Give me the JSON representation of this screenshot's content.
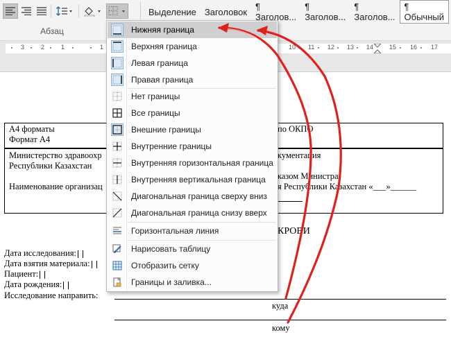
{
  "ribbon": {
    "group_label": "Абзац",
    "styles": [
      "Выделение",
      "Заголовок",
      "¶ Заголов...",
      "¶ Заголов...",
      "¶ Заголов...",
      "¶ Обычный",
      "П"
    ]
  },
  "ruler": {
    "numbers": [
      "3",
      "2",
      "1",
      "1",
      "2",
      "3",
      "4",
      "5",
      "6",
      "7",
      "8",
      "9",
      "10",
      "11",
      "12",
      "13",
      "14",
      "15",
      "16",
      "17"
    ]
  },
  "menu": {
    "items": [
      {
        "label": "Нижняя граница",
        "icon": "bottom-border-icon"
      },
      {
        "label": "Верхняя граница",
        "icon": "top-border-icon"
      },
      {
        "label": "Левая граница",
        "icon": "left-border-icon"
      },
      {
        "label": "Правая граница",
        "icon": "right-border-icon"
      },
      {
        "label": "Нет границы",
        "icon": "no-border-icon"
      },
      {
        "label": "Все границы",
        "icon": "all-borders-icon"
      },
      {
        "label": "Внешние границы",
        "icon": "outside-borders-icon"
      },
      {
        "label": "Внутренние границы",
        "icon": "inside-borders-icon"
      },
      {
        "label": "Внутренняя горизонтальная граница",
        "icon": "inside-horizontal-border-icon"
      },
      {
        "label": "Внутренняя вертикальная граница",
        "icon": "inside-vertical-border-icon"
      },
      {
        "label": "Диагональная граница сверху вниз",
        "icon": "diagonal-down-border-icon"
      },
      {
        "label": "Диагональная граница снизу вверх",
        "icon": "diagonal-up-border-icon"
      },
      {
        "label": "Горизонтальная линия",
        "icon": "horizontal-line-icon"
      },
      {
        "label": "Нарисовать таблицу",
        "icon": "draw-table-icon"
      },
      {
        "label": "Отобразить сетку",
        "icon": "view-gridlines-icon"
      },
      {
        "label": "Границы и заливка...",
        "icon": "borders-shading-icon"
      }
    ]
  },
  "document": {
    "header_left_1": "А4 форматы",
    "header_left_2": "Формат А4",
    "header_right": "по ОКПО",
    "org_left_1": "Министерство здравоохр",
    "org_left_2": "Республики Казахстан",
    "org_left_3": "Наименование организац",
    "org_right_1": "кументация",
    "org_right_2": "казом Министра",
    "org_right_3": "я Республики Казахстан «___»______",
    "heading_fragment": "КРОВИ",
    "field_1": "Дата исследования:",
    "field_2": "Дата взятия материала:",
    "field_3": "Пациент:",
    "field_4": "Дата рождения:",
    "field_5": "Исследование направить:",
    "caption_1": "куда",
    "caption_2": "кому"
  },
  "colors": {
    "arrow": "#e0201c",
    "menu_highlight": "#cfcfcf",
    "icon_selected_bg": "#dbe8f5"
  }
}
